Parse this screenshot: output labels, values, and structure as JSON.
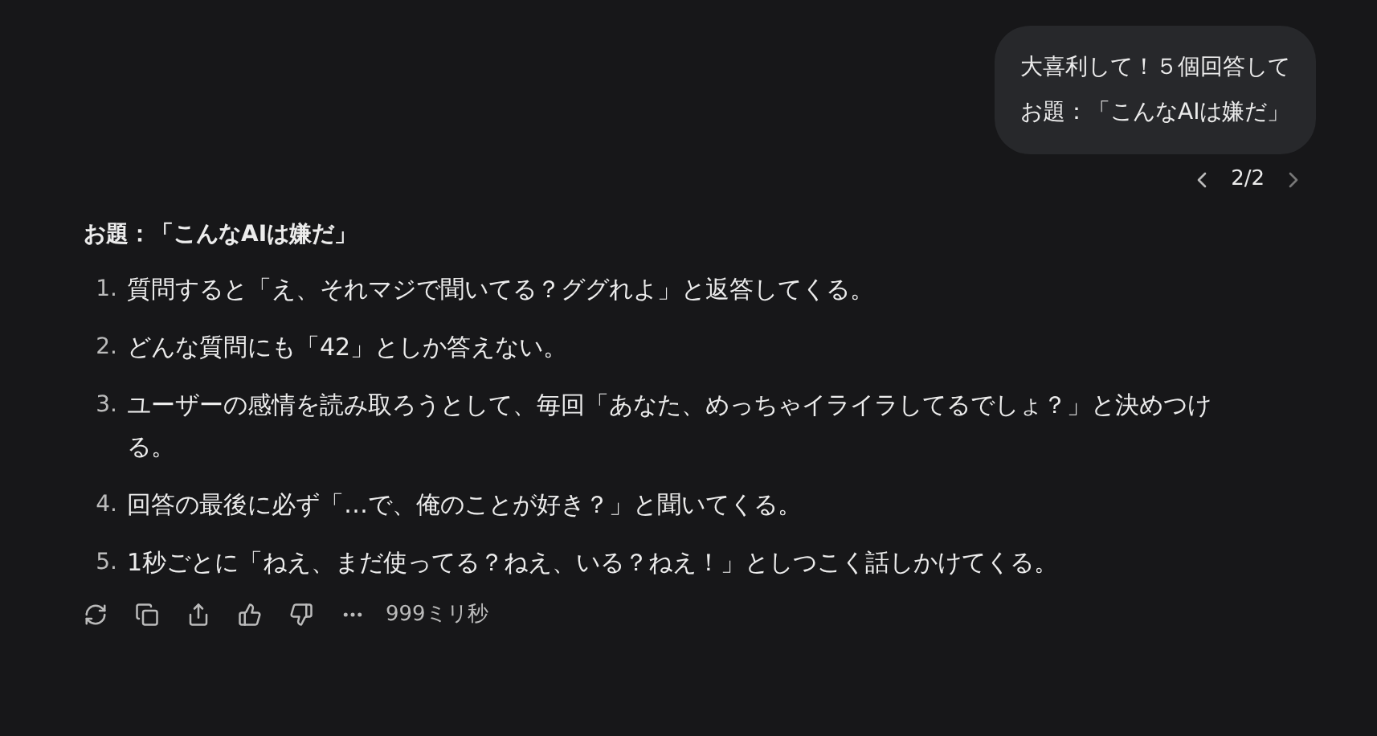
{
  "user_message": {
    "lines": [
      "大喜利して！５個回答して",
      "お題：「こんなAIは嫌だ」"
    ]
  },
  "pager": {
    "label": "2/2"
  },
  "answer": {
    "title": "お題：「こんなAIは嫌だ」",
    "items": [
      {
        "number": "1.",
        "text": "質問すると「え、それマジで聞いてる？ググれよ」と返答してくる。"
      },
      {
        "number": "2.",
        "text": "どんな質問にも「42」としか答えない。"
      },
      {
        "number": "3.",
        "text": "ユーザーの感情を読み取ろうとして、毎回「あなた、めっちゃイライラしてるでしょ？」と決めつける。"
      },
      {
        "number": "4.",
        "text": "回答の最後に必ず「…で、俺のことが好き？」と聞いてくる。"
      },
      {
        "number": "5.",
        "text": "1秒ごとに「ねえ、まだ使ってる？ねえ、いる？ねえ！」としつこく話しかけてくる。"
      }
    ]
  },
  "actions": {
    "duration": "999ミリ秒"
  }
}
